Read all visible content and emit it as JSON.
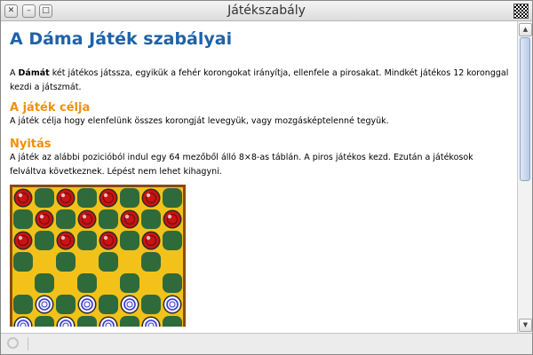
{
  "window": {
    "title": "Játékszabály"
  },
  "icons": {
    "close": "close-icon",
    "minimize": "minimize-icon",
    "maximize": "maximize-icon",
    "app": "checkerboard-icon"
  },
  "doc": {
    "heading": "A Dáma Játék szabályai",
    "intro_prefix": "A ",
    "intro_bold": "Dámát",
    "intro_rest": " két játékos játssza, egyikük a fehér korongokat irányítja, ellenfele a pirosakat. Mindkét játékos 12 koronggal kezdi a játszmát.",
    "goal_title": "A játék célja",
    "goal_text": "A játék célja hogy elenfelünk összes korongját levegyük, vagy mozgásképtelenné tegyük.",
    "opening_title": "Nyitás",
    "opening_text": "A játék az alábbi pozicióból indul egy 64 mezőből álló 8×8-as táblán. A piros játékos kezd. Ezután a játékosok felváltva következnek. Lépést nem lehet kihagyni."
  },
  "board": {
    "light_color": "#f2c21a",
    "dark_color": "#2f6a3a",
    "frame_color": "#8a4a12",
    "red_piece_color": "#c81414",
    "white_piece_color": "#f4f4ff",
    "white_ring_color": "#3a3ad0"
  },
  "colors": {
    "heading": "#1f62a8",
    "section_heading": "#f0900a"
  }
}
